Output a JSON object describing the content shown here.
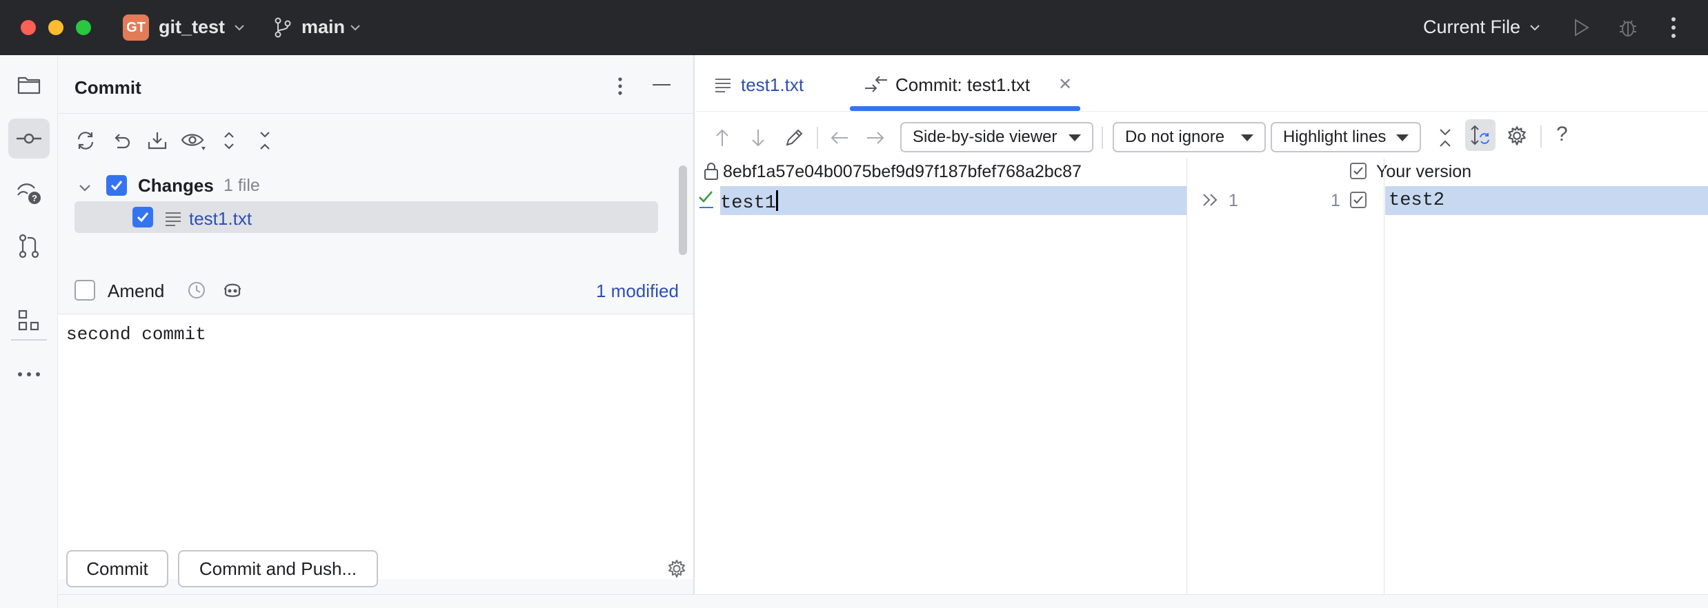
{
  "window": {
    "project_badge": "GT",
    "project_name": "git_test",
    "branch": "main",
    "run_config": "Current File",
    "icons": [
      "branch-icon",
      "run-icon",
      "debug-icon",
      "more-icon"
    ]
  },
  "sidebar": {
    "items": [
      {
        "name": "project",
        "icon": "folder-icon"
      },
      {
        "name": "commit",
        "icon": "commit-icon",
        "active": true
      },
      {
        "name": "pull-requests-help",
        "icon": "vcs-help-icon"
      },
      {
        "name": "pull-requests",
        "icon": "pull-request-icon"
      },
      {
        "name": "structure",
        "icon": "structure-icon"
      },
      {
        "name": "more",
        "icon": "ellipsis-icon"
      }
    ]
  },
  "commit_panel": {
    "title": "Commit",
    "toolbar_icons": [
      "refresh-icon",
      "rollback-icon",
      "update-icon",
      "preview-icon",
      "expand-all-icon",
      "collapse-all-icon"
    ],
    "changes_label": "Changes",
    "changes_count": "1 file",
    "file_name": "test1.txt",
    "amend_label": "Amend",
    "modified_link": "1 modified",
    "commit_message": "second commit",
    "commit_button": "Commit",
    "commit_push_button": "Commit and Push..."
  },
  "editor": {
    "tabs": [
      {
        "label": "test1.txt",
        "active": false
      },
      {
        "label": "Commit: test1.txt",
        "active": true
      }
    ]
  },
  "diff": {
    "viewer_mode": "Side-by-side viewer",
    "ignore_mode": "Do not ignore",
    "highlight_mode": "Highlight lines",
    "left_header": "8ebf1a57e04b0075bef9d97f187bfef768a2bc87",
    "right_header": "Your version",
    "left_line": "test1",
    "right_line": "test2",
    "left_line_number": "1",
    "right_line_number": "1",
    "help_label": "?"
  },
  "colors": {
    "accent": "#3574f0",
    "link": "#2d4fb3",
    "titlebar": "#27282c",
    "diff_highlight": "#c8d8f0"
  }
}
